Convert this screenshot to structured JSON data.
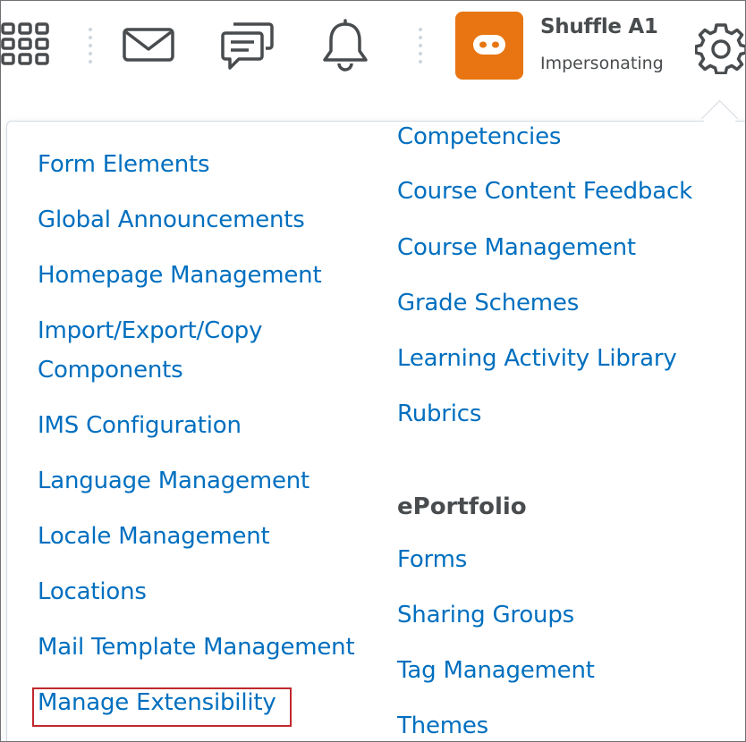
{
  "navbar": {
    "user": {
      "name": "Shuffle A1",
      "role": "Impersonating"
    },
    "icons": [
      "grid-icon",
      "mail-icon",
      "chat-icon",
      "bell-icon",
      "gear-icon"
    ],
    "avatar_color": "#e87511"
  },
  "menu": {
    "left_column": [
      "Form Elements",
      "Global Announcements",
      "Homepage Management",
      "Import/Export/Copy",
      "Components",
      "IMS Configuration",
      "Language Management",
      "Locale Management",
      "Locations",
      "Mail Template Management",
      "Manage Extensibility"
    ],
    "right_column": [
      "Competencies",
      "Course Content Feedback",
      "Course Management",
      "Grade Schemes",
      "Learning Activity Library",
      "Rubrics"
    ],
    "eportfolio": {
      "heading": "ePortfolio",
      "items": [
        "Forms",
        "Sharing Groups",
        "Tag Management",
        "Themes"
      ]
    },
    "link_color": "#006fbf",
    "highlight_color": "#c0282e"
  }
}
